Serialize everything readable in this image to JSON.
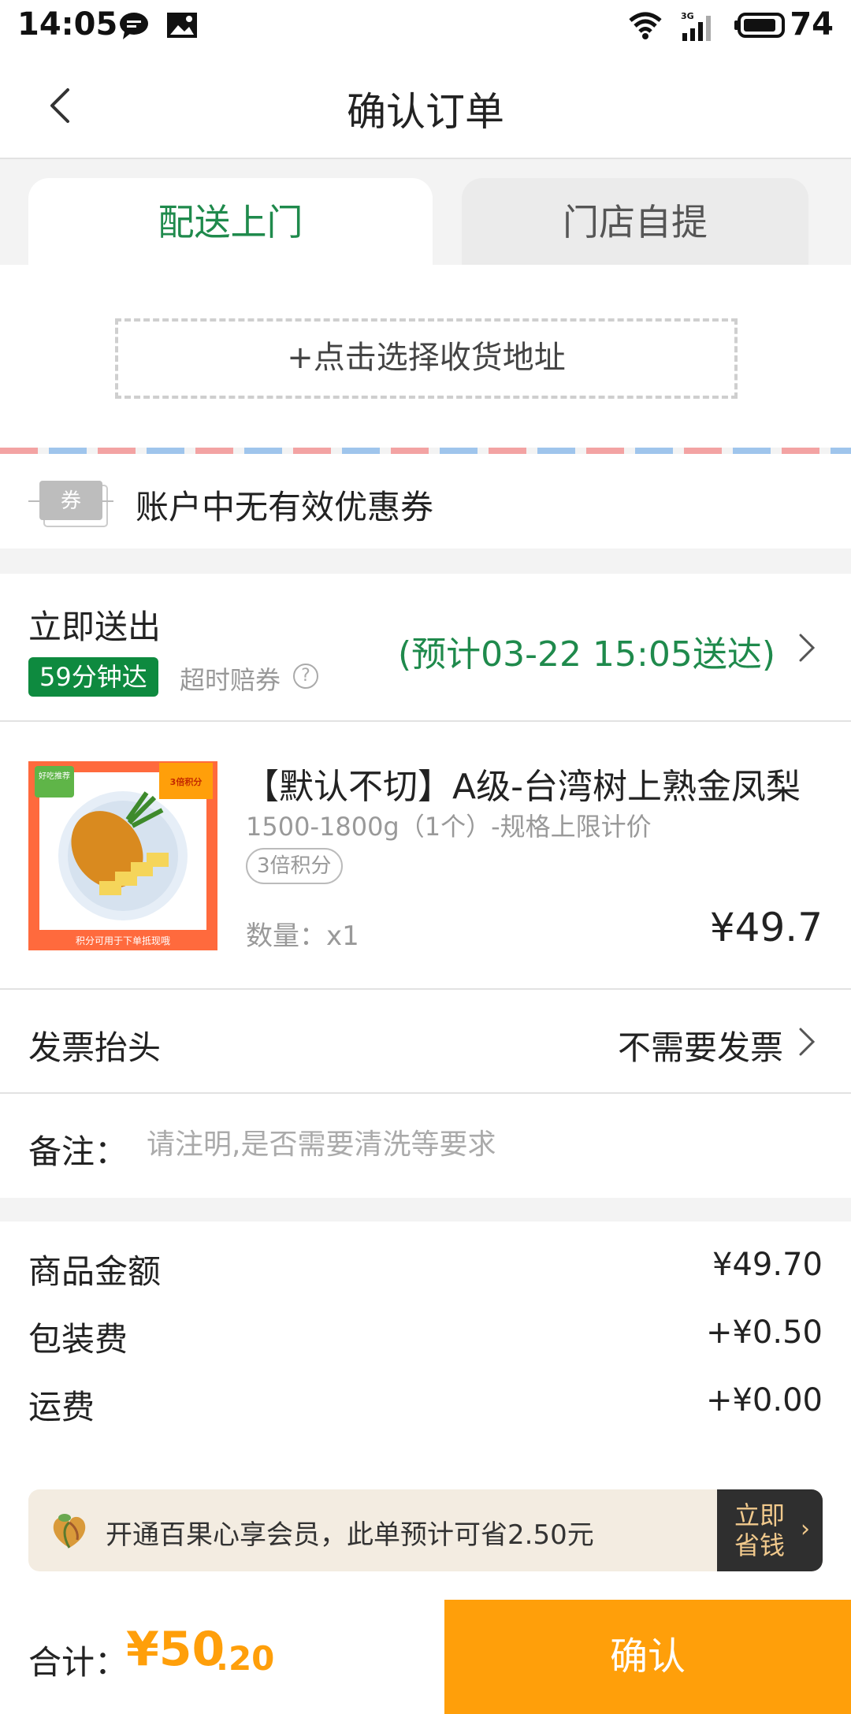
{
  "status_bar": {
    "time": "14:05",
    "network": "3G",
    "battery": "74"
  },
  "header": {
    "title": "确认订单"
  },
  "tabs": [
    {
      "label": "配送上门",
      "active": true
    },
    {
      "label": "门店自提",
      "active": false
    }
  ],
  "address": {
    "prompt": "+点击选择收货地址"
  },
  "coupon": {
    "icon_text": "券",
    "message": "账户中无有效优惠券"
  },
  "delivery": {
    "label": "立即送出",
    "badge": "59分钟达",
    "timeout": "超时赔券",
    "eta": "(预计03-22 15:05送达)"
  },
  "product": {
    "name": "【默认不切】A级-台湾树上熟金凤梨",
    "spec": "1500-1800g（1个）-规格上限计价",
    "tag": "3倍积分",
    "quantity": "数量：x1",
    "price": "¥49.7",
    "thumb_badge_left": "好吃推荐",
    "thumb_badge_right": "3倍积分",
    "thumb_caption": "积分可用于下单抵现哦"
  },
  "invoice": {
    "label": "发票抬头",
    "value": "不需要发票"
  },
  "remark": {
    "label": "备注：",
    "placeholder": "请注明,是否需要清洗等要求"
  },
  "summary": {
    "items": [
      {
        "label": "商品金额",
        "value": "¥49.70"
      },
      {
        "label": "包装费",
        "value": "+¥0.50"
      },
      {
        "label": "运费",
        "value": "+¥0.00"
      }
    ]
  },
  "membership": {
    "text": "开通百果心享会员，此单预计可省2.50元",
    "button_line1": "立即",
    "button_line2": "省钱",
    "arrow": "›"
  },
  "footer": {
    "total_label": "合计：",
    "total_int": "¥50",
    "total_dec": ".20",
    "confirm_label": "确认"
  },
  "colors": {
    "accent_green": "#1f8a4c",
    "accent_orange": "#ff9f0a",
    "badge_green": "#0e8a3f"
  }
}
